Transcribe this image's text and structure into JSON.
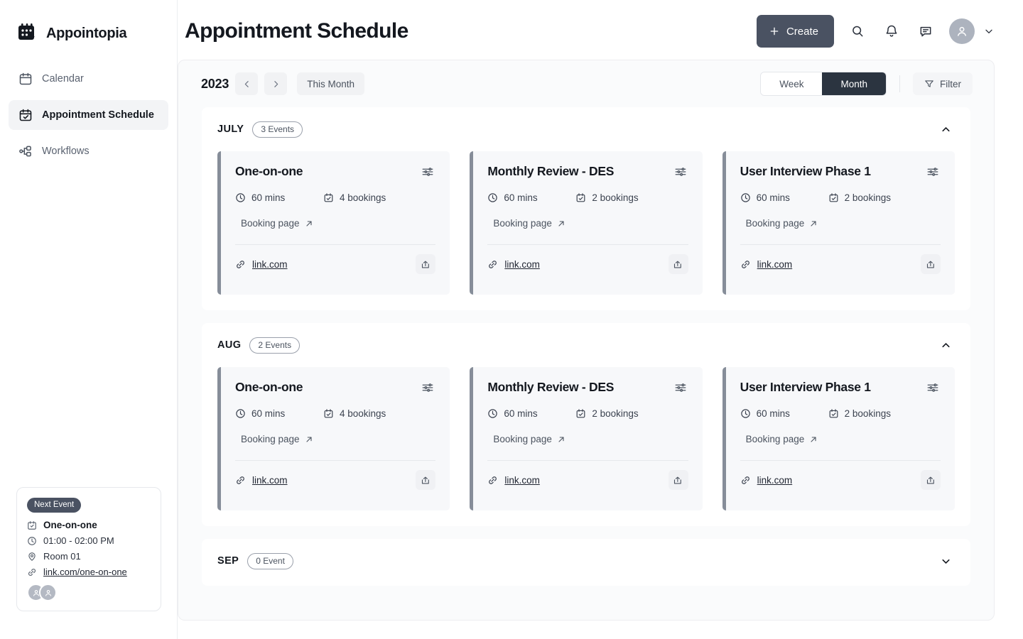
{
  "brand": {
    "name": "Appointopia",
    "logo_icon": "calendar-leaf-logo-icon"
  },
  "sidebar": {
    "items": [
      {
        "label": "Calendar",
        "icon": "calendar-icon",
        "active": false
      },
      {
        "label": "Appointment Schedule",
        "icon": "calendar-check-icon",
        "active": true
      },
      {
        "label": "Workflows",
        "icon": "workflow-icon",
        "active": false
      }
    ],
    "next_event": {
      "badge": "Next Event",
      "title": "One-on-one",
      "time": "01:00 - 02:00 PM",
      "location": "Room 01",
      "link": "link.com/one-on-one",
      "attendee_count": 2
    }
  },
  "header": {
    "title": "Appointment Schedule",
    "create_label": "Create",
    "actions": [
      "search-icon",
      "bell-icon",
      "chat-icon"
    ]
  },
  "toolbar": {
    "year": "2023",
    "prev_label": "‹",
    "next_label": "›",
    "this_month_label": "This Month",
    "views": [
      {
        "label": "Week",
        "active": false
      },
      {
        "label": "Month",
        "active": true
      }
    ],
    "filter_label": "Filter"
  },
  "colors": {
    "accent_dark": "#4a5262",
    "toggle_active": "#2b3440",
    "card_bar": "#868d99",
    "card_bg": "#f7f8fa",
    "panel_bg": "#fafbfc"
  },
  "months": [
    {
      "name": "JULY",
      "count_label": "3 Events",
      "expanded": true,
      "chevron": "chevron-up-icon",
      "events": [
        {
          "title": "One-on-one",
          "duration": "60 mins",
          "bookings": "4 bookings",
          "booking_page": "Booking page",
          "link": "link.com"
        },
        {
          "title": "Monthly Review - DES",
          "duration": "60 mins",
          "bookings": "2 bookings",
          "booking_page": "Booking page",
          "link": "link.com"
        },
        {
          "title": "User Interview Phase 1",
          "duration": "60 mins",
          "bookings": "2 bookings",
          "booking_page": "Booking page",
          "link": "link.com"
        }
      ]
    },
    {
      "name": "AUG",
      "count_label": "2 Events",
      "expanded": true,
      "chevron": "chevron-up-icon",
      "events": [
        {
          "title": "One-on-one",
          "duration": "60 mins",
          "bookings": "4 bookings",
          "booking_page": "Booking page",
          "link": "link.com"
        },
        {
          "title": "Monthly Review - DES",
          "duration": "60 mins",
          "bookings": "2 bookings",
          "booking_page": "Booking page",
          "link": "link.com"
        },
        {
          "title": "User Interview Phase 1",
          "duration": "60 mins",
          "bookings": "2 bookings",
          "booking_page": "Booking page",
          "link": "link.com"
        }
      ]
    },
    {
      "name": "SEP",
      "count_label": "0 Event",
      "expanded": false,
      "chevron": "chevron-down-icon",
      "events": []
    }
  ]
}
